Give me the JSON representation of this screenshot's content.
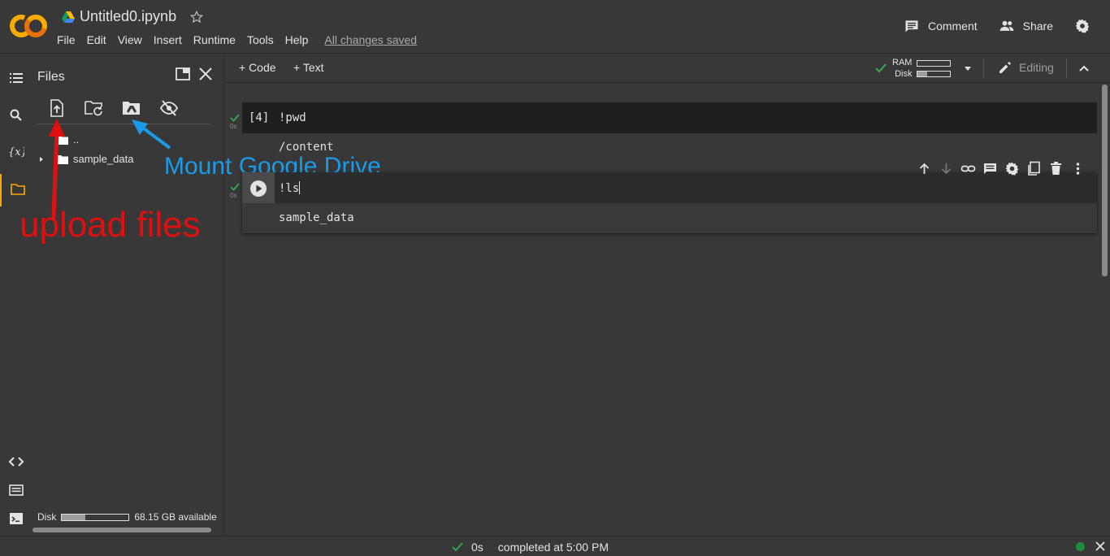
{
  "colors": {
    "accent_orange": "#f9ab00",
    "success_green": "#34a853",
    "annotation_red": "#e01010",
    "annotation_blue": "#1a9be6",
    "status_dot": "#1e8e3e"
  },
  "header": {
    "logo_text": "CO",
    "notebook_title": "Untitled0.ipynb",
    "menu": [
      "File",
      "Edit",
      "View",
      "Insert",
      "Runtime",
      "Tools",
      "Help"
    ],
    "save_status": "All changes saved",
    "comment_label": "Comment",
    "share_label": "Share",
    "icons": [
      "drive-icon",
      "star-icon",
      "comment-icon",
      "share-icon",
      "settings-icon"
    ]
  },
  "rail": {
    "icons": [
      "table-of-contents-icon",
      "search-icon",
      "variables-icon",
      "files-icon",
      "code-snippets-icon",
      "command-palette-icon",
      "terminal-icon"
    ],
    "active": "files-icon"
  },
  "files": {
    "title": "Files",
    "toolbar_icons": [
      "upload-file-icon",
      "refresh-folder-icon",
      "mount-drive-icon",
      "hide-hidden-files-icon"
    ],
    "tree": [
      {
        "label": "..",
        "type": "parent"
      },
      {
        "label": "sample_data",
        "type": "folder",
        "expandable": true
      }
    ],
    "disk_label": "Disk",
    "disk_used_fraction": 0.35,
    "disk_available": "68.15 GB available"
  },
  "annotations": {
    "upload": "upload files",
    "mount": "Mount Google Drive"
  },
  "toolbar": {
    "add_code": "+ Code",
    "add_text": "+ Text",
    "ram_label": "RAM",
    "disk_label": "Disk",
    "ram_fraction": 0.0,
    "disk_fraction": 0.3,
    "editing_label": "Editing"
  },
  "cells": [
    {
      "count": "[4]",
      "code": "!pwd",
      "output": "/content",
      "exec_time": "0s"
    },
    {
      "count": "",
      "code": "!ls",
      "output": "sample_data",
      "exec_time": "0s"
    }
  ],
  "cell_toolbar_icons": [
    "move-up-icon",
    "move-down-icon",
    "link-icon",
    "comment-icon",
    "cell-settings-icon",
    "mirror-cell-icon",
    "delete-icon",
    "more-icon"
  ],
  "status": {
    "time": "0s",
    "message": "completed at 5:00 PM"
  }
}
